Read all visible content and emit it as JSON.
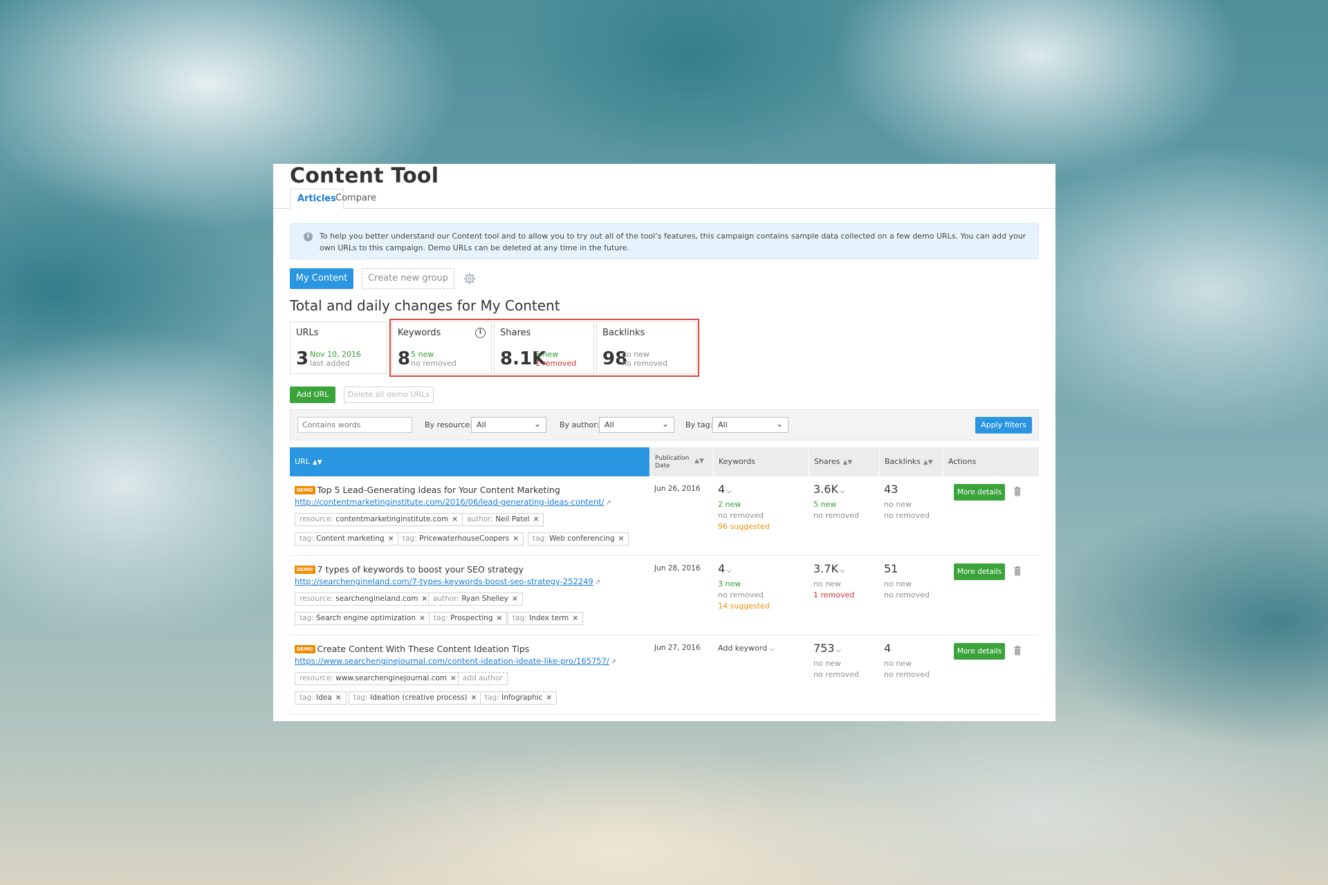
{
  "app": {
    "title": "Content Tool"
  },
  "tabs": [
    {
      "label": "Articles"
    },
    {
      "label": "Compare"
    }
  ],
  "notice": {
    "icon": "info-icon",
    "text": "To help you better understand our Content tool and to allow you to try out all of the tool’s features, this campaign contains sample data collected on a few demo URLs. You can add your own URLs to this campaign. Demo URLs can be deleted at any time in the future."
  },
  "groups": {
    "my_content": "My Content",
    "create_new": "Create new group",
    "settings_icon": "gear-icon"
  },
  "section_title": "Total and daily changes for My Content",
  "stats": {
    "urls": {
      "label": "URLs",
      "value": "3",
      "line1": "Nov 10, 2016",
      "line2": "last added"
    },
    "keywords": {
      "label": "Keywords",
      "value": "8",
      "line1": "5 new",
      "line2": "no removed"
    },
    "shares": {
      "label": "Shares",
      "value": "8.1K",
      "line1": "5 new",
      "line2": "1 removed"
    },
    "backlinks": {
      "label": "Backlinks",
      "value": "98",
      "line1": "no new",
      "line2": "no removed"
    }
  },
  "buttons": {
    "add_url": "Add URL",
    "delete_demo": "Delete all demo URLs",
    "apply_filters": "Apply filters",
    "more_details": "More details"
  },
  "filters": {
    "search_placeholder": "Contains words",
    "by_resource": "By resource:",
    "resource_value": "All",
    "by_author": "By author:",
    "author_value": "All",
    "by_tag": "By tag:",
    "tag_value": "All"
  },
  "table": {
    "headers": {
      "url": "URL",
      "pub_line1": "Publication",
      "pub_line2": "Date",
      "keywords": "Keywords",
      "shares": "Shares",
      "backlinks": "Backlinks",
      "actions": "Actions"
    },
    "rows": [
      {
        "badge": "DEMO",
        "title": "Top 5 Lead-Generating Ideas for Your Content Marketing",
        "url": "http://contentmarketinginstitute.com/2016/06/lead-generating-ideas-content/",
        "resource": "contentmarketinginstitute.com",
        "author": "Neil Patel",
        "tags": [
          "Content marketing",
          "PricewaterhouseCoopers",
          "Web conferencing"
        ],
        "date": "Jun 26, 2016",
        "keywords": {
          "value": "4",
          "l1": "2 new",
          "l2": "no removed",
          "l3": "96 suggested"
        },
        "shares": {
          "value": "3.6K",
          "l1": "5 new",
          "l2": "no removed"
        },
        "backlinks": {
          "value": "43",
          "l1": "no new",
          "l2": "no removed"
        }
      },
      {
        "badge": "DEMO",
        "title": "7 types of keywords to boost your SEO strategy",
        "url": "http://searchengineland.com/7-types-keywords-boost-seo-strategy-252249",
        "resource": "searchengineland.com",
        "author": "Ryan Shelley",
        "tags": [
          "Search engine optimization",
          "Prospecting",
          "Index term"
        ],
        "date": "Jun 28, 2016",
        "keywords": {
          "value": "4",
          "l1": "3 new",
          "l2": "no removed",
          "l3": "14 suggested"
        },
        "shares": {
          "value": "3.7K",
          "l1": "no new",
          "l2": "1 removed"
        },
        "backlinks": {
          "value": "51",
          "l1": "no new",
          "l2": "no removed"
        }
      },
      {
        "badge": "DEMO",
        "title": "Create Content With These Content Ideation Tips",
        "url": "https://www.searchenginejournal.com/content-ideation-ideate-like-pro/165757/",
        "resource": "www.searchenginejournal.com",
        "add_author": "add author",
        "tags": [
          "Idea",
          "Ideation (creative process)",
          "Infographic"
        ],
        "date": "Jun 27, 2016",
        "keywords": {
          "add": "Add keyword"
        },
        "shares": {
          "value": "753",
          "l1": "no new",
          "l2": "no removed"
        },
        "backlinks": {
          "value": "4",
          "l1": "no new",
          "l2": "no removed"
        }
      }
    ]
  },
  "labels": {
    "resource_key": "resource:",
    "author_key": "author:",
    "tag_key": "tag:"
  },
  "colors": {
    "accent": "#2a95e0",
    "green": "#3aa33a",
    "highlight": "#e0453a",
    "demo": "#f08a00"
  }
}
